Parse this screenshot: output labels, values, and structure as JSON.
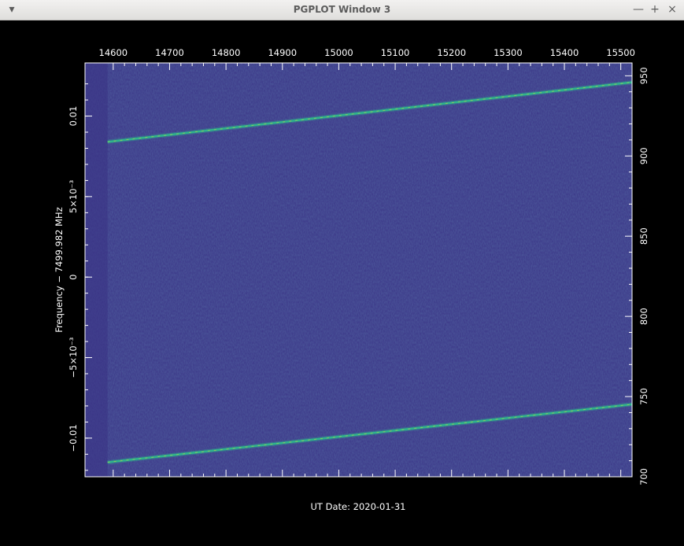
{
  "window": {
    "title": "PGPLOT Window 3",
    "menu_icon": "chevron-down-icon",
    "minimize_label": "—",
    "maximize_label": "+",
    "close_label": "×"
  },
  "chart_data": {
    "type": "heatmap",
    "xlabel": "UT Date: 2020-01-31",
    "ylabel": "Frequency − 7499.982 MHz",
    "top_axis": {
      "range": [
        14550,
        15520
      ],
      "ticks": [
        "14600",
        "14700",
        "14800",
        "14900",
        "15000",
        "15100",
        "15200",
        "15300",
        "15400",
        "15500"
      ]
    },
    "left_axis": {
      "range": [
        -0.0124,
        0.0133
      ],
      "ticks": [
        {
          "value": 0.01,
          "label": "0.01"
        },
        {
          "value": 0.005,
          "label": "5×10⁻³"
        },
        {
          "value": 0,
          "label": "0"
        },
        {
          "value": -0.005,
          "label": "−5×10⁻³"
        },
        {
          "value": -0.01,
          "label": "−0.01"
        }
      ]
    },
    "right_axis": {
      "range": [
        700,
        958
      ],
      "ticks": [
        "700",
        "750",
        "800",
        "850",
        "900",
        "950"
      ]
    },
    "data_start_x": 14590,
    "signal_lines": [
      {
        "x": [
          14590,
          15520
        ],
        "y": [
          0.0084,
          0.0121
        ]
      },
      {
        "x": [
          14590,
          15520
        ],
        "y": [
          -0.0115,
          -0.0079
        ]
      }
    ],
    "colors": {
      "background": "#3a3486",
      "signal": "#2fb58c",
      "signal_peak": "#d9e03a",
      "axes": "#ffffff"
    },
    "grid": false,
    "legend": "none"
  }
}
